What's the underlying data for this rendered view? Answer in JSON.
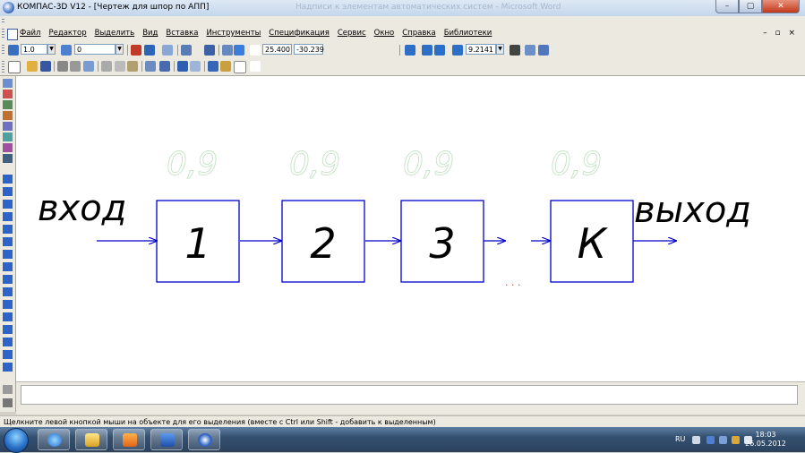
{
  "window": {
    "title": "КОМПАС-3D V12 - [Чертеж для шпор по АПП]",
    "faded_title": "Надписи к элементам автоматических систем - Microsoft Word",
    "min_label": "–",
    "max_label": "▢",
    "close_label": "✕"
  },
  "menu": {
    "items": [
      "Файл",
      "Редактор",
      "Выделить",
      "Вид",
      "Вставка",
      "Инструменты",
      "Спецификация",
      "Сервис",
      "Окно",
      "Справка",
      "Библиотеки"
    ],
    "mdi_controls": "– ▫ ×"
  },
  "toolbar": {
    "line_width": "1.0",
    "layer": "0",
    "coord_x": "25.400",
    "coord_y": "-30.239",
    "zoom": "9.2141"
  },
  "diagram": {
    "input_label": "вход",
    "output_label": "выход",
    "blocks": [
      "1",
      "2",
      "3",
      "К"
    ],
    "coefficients": [
      "0,9",
      "0,9",
      "0,9",
      "0,9"
    ],
    "ellipsis": "· · ·",
    "colors": {
      "block": "#0000cc",
      "arrow": "#0000cc",
      "text": "#000000",
      "coef": "#cfe8cf",
      "dots": "#e04040"
    }
  },
  "status": {
    "hint": "Щелкните левой кнопкой мыши на объекте для его выделения (вместе с Ctrl или Shift - добавить к выделенным)"
  },
  "taskbar": {
    "language": "RU",
    "time": "18:03",
    "date": "26.05.2012"
  }
}
